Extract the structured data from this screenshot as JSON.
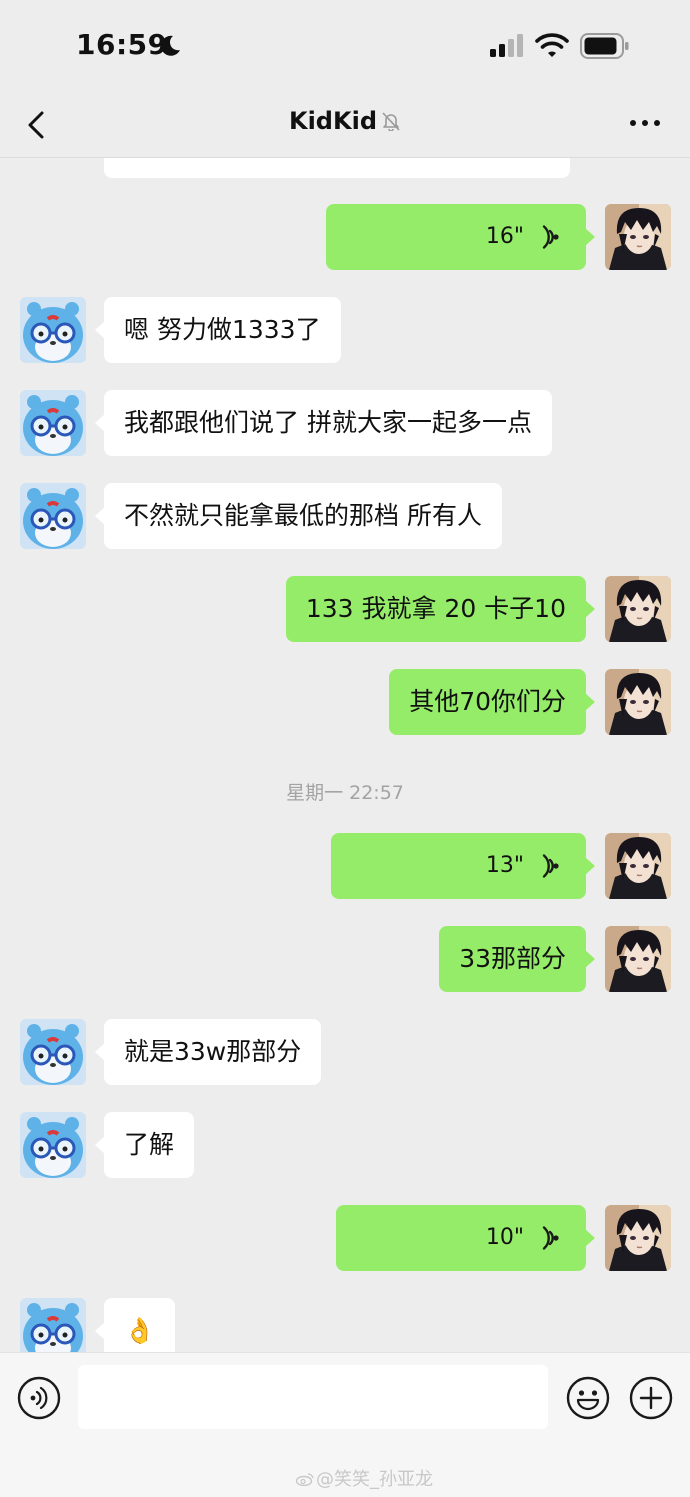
{
  "status_bar": {
    "time": "16:59",
    "icons": [
      "moon-icon",
      "signal-icon",
      "wifi-icon",
      "battery-icon"
    ]
  },
  "nav": {
    "title": "KidKid",
    "back_icon": "chevron-left-icon",
    "muted_icon": "bell-off-icon",
    "more_icon": "more-horizontal-icon"
  },
  "messages": [
    {
      "sender": "self",
      "type": "voice",
      "duration": "16\""
    },
    {
      "sender": "contact",
      "type": "text",
      "text": "嗯 努力做1333了"
    },
    {
      "sender": "contact",
      "type": "text",
      "text": "我都跟他们说了 拼就大家一起多一点"
    },
    {
      "sender": "contact",
      "type": "text",
      "text": "不然就只能拿最低的那档 所有人"
    },
    {
      "sender": "self",
      "type": "text",
      "text": "133 我就拿 20 卡子10"
    },
    {
      "sender": "self",
      "type": "text",
      "text": "其他70你们分"
    },
    {
      "type": "timestamp",
      "text": "星期一 22:57"
    },
    {
      "sender": "self",
      "type": "voice",
      "duration": "13\""
    },
    {
      "sender": "self",
      "type": "text",
      "text": "33那部分"
    },
    {
      "sender": "contact",
      "type": "text",
      "text": "就是33w那部分"
    },
    {
      "sender": "contact",
      "type": "text",
      "text": "了解"
    },
    {
      "sender": "self",
      "type": "voice",
      "duration": "10\""
    },
    {
      "sender": "contact",
      "type": "text",
      "text": "👌"
    }
  ],
  "input_bar": {
    "voice_icon": "voice-mode-icon",
    "emoji_icon": "emoji-icon",
    "plus_icon": "plus-icon",
    "value": ""
  },
  "watermark": {
    "text": "@笑笑_孙亚龙"
  },
  "colors": {
    "background": "#ededed",
    "outgoing_bubble": "#95ec69",
    "incoming_bubble": "#ffffff",
    "timestamp": "#a3a3a3"
  }
}
